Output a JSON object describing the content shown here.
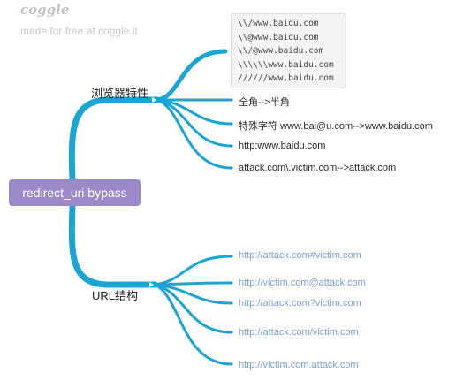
{
  "brand": {
    "name": "coggle",
    "tagline": "made for free at coggle.it"
  },
  "colors": {
    "branch": "#1aa5d4",
    "root": "#9b8ac9",
    "leaf_link": "#7b9fd6"
  },
  "root": {
    "label": "redirect_uri bypass"
  },
  "branches": [
    {
      "label": "浏览器特性",
      "code_lines": [
        "\\\\/www.baidu.com",
        "\\\\@www.baidu.com",
        "\\\\/@www.baidu.com",
        "\\\\\\\\\\\\www.baidu.com",
        "//////www.baidu.com"
      ],
      "items": [
        "全角-->半角",
        "特殊字符 www.bai@u.com-->www.baidu.com",
        "http:www.baidu.com",
        "attack.com\\.victim.com-->attack.com"
      ]
    },
    {
      "label": "URL结构",
      "items": [
        "http://attack.com#victim.com",
        "http://victim.com@attack.com",
        "http://attack.com?victim.com",
        "http://attack.com/victim.com",
        "http://victim.com.attack.com"
      ]
    }
  ]
}
